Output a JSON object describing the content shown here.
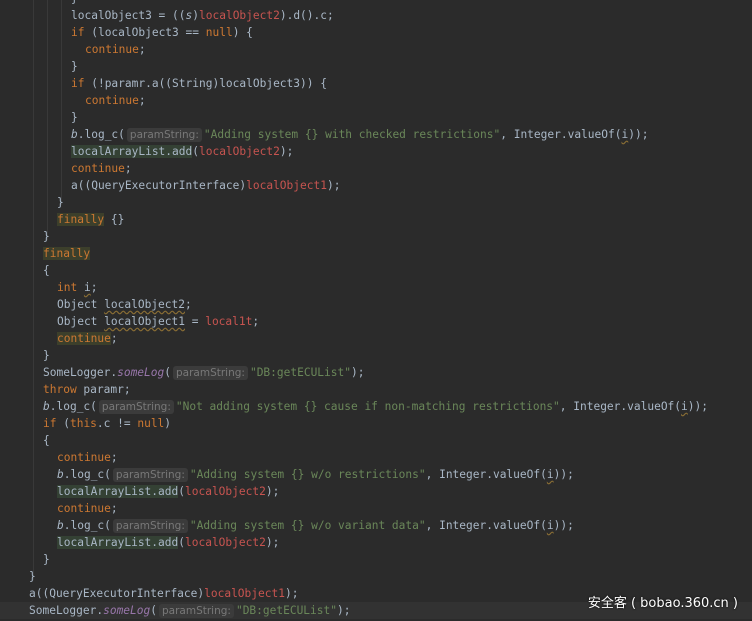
{
  "code_lines": [
    "}",
    "localObject3 = ((s)localObject2).d().c;",
    "if (localObject3 == null) {",
    "continue;",
    "}",
    "if (!paramr.a((String)localObject3)) {",
    "continue;",
    "}",
    "b.log_c( paramString: \"Adding system {} with checked restrictions\", Integer.valueOf(i));",
    "localArrayList.add(localObject2);",
    "continue;",
    "a((QueryExecutorInterface)localObject1);",
    "}",
    "finally {}",
    "}",
    "finally",
    "{",
    "int i;",
    "Object localObject2;",
    "Object localObject1 = local1t;",
    "continue;",
    "}",
    "SomeLogger.someLog( paramString: \"DB:getECUList\");",
    "throw paramr;",
    "b.log_c( paramString: \"Not adding system {} cause if non-matching restrictions\", Integer.valueOf(i));",
    "if (this.c != null)",
    "{",
    "continue;",
    "b.log_c( paramString: \"Adding system {} w/o restrictions\", Integer.valueOf(i));",
    "localArrayList.add(localObject2);",
    "continue;",
    "b.log_c( paramString: \"Adding system {} w/o variant data\", Integer.valueOf(i));",
    "localArrayList.add(localObject2);",
    "}",
    "}",
    "a((QueryExecutorInterface)localObject1);",
    "SomeLogger.someLog( paramString: \"DB:getECUList\");"
  ],
  "param_hint": "paramString:",
  "watermark": "安全客 ( bobao.360.cn )",
  "colors": {
    "background": "#2b2b2b",
    "keyword": "#cc7832",
    "string": "#6a8759",
    "field": "#9876aa",
    "local_var": "#c75450",
    "default_text": "#a9b7c6"
  }
}
